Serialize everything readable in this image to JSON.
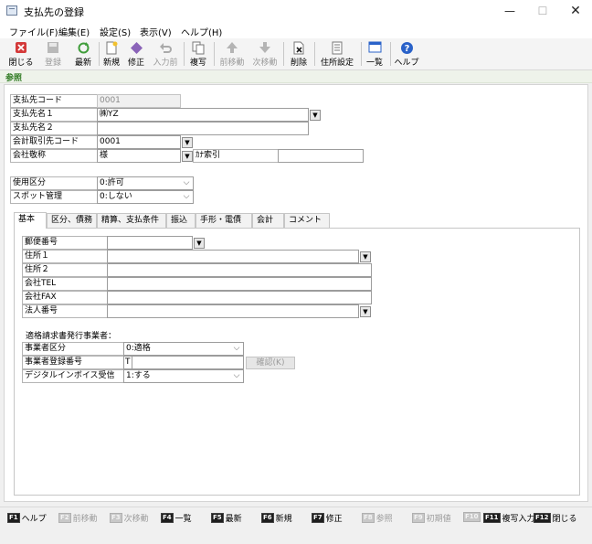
{
  "window": {
    "title": "支払先の登録",
    "minimize": "—",
    "maximize": "☐",
    "close": "✕"
  },
  "menu": [
    "ファイル(F)",
    "編集(E)",
    "設定(S)",
    "表示(V)",
    "ヘルプ(H)"
  ],
  "toolbar": {
    "close": "閉じる",
    "register": "登録",
    "refresh": "最新",
    "new": "新規",
    "edit": "修正",
    "input_before": "入力前",
    "copy": "複写",
    "prev": "前移動",
    "next": "次移動",
    "delete": "削除",
    "address_setting": "住所設定",
    "list": "一覧",
    "help": "ヘルプ"
  },
  "mode": "参照",
  "header_fields": {
    "code_label": "支払先コード",
    "code_value": "0001",
    "name1_label": "支払先名１",
    "name1_value": "㈱YZ",
    "name2_label": "支払先名２",
    "name2_value": "",
    "acct_label": "会計取引先コード",
    "acct_value": "0001",
    "honorific_label": "会社敬称",
    "honorific_value": "様",
    "kana_label": "ｶﾅ索引",
    "kana_value": "",
    "usage_label": "使用区分",
    "usage_value": "0:許可",
    "spot_label": "スポット管理",
    "spot_value": "0:しない"
  },
  "tabs": [
    "基本",
    "区分、債務",
    "精算、支払条件",
    "振込",
    "手形・電債",
    "会計",
    "コメント"
  ],
  "basic": {
    "postal_label": "郵便番号",
    "postal_value": "",
    "addr1_label": "住所１",
    "addr1_value": "",
    "addr2_label": "住所２",
    "addr2_value": "",
    "tel_label": "会社TEL",
    "tel_value": "",
    "fax_label": "会社FAX",
    "fax_value": "",
    "corp_no_label": "法人番号",
    "corp_no_value": "",
    "invoice_heading": "適格請求書発行事業者：",
    "biz_type_label": "事業者区分",
    "biz_type_value": "0:適格",
    "reg_no_label": "事業者登録番号",
    "reg_no_prefix": "T",
    "reg_no_value": "",
    "check_button": "確認(K)",
    "digital_label": "デジタルインボイス受信",
    "digital_value": "1:する"
  },
  "fkeys": [
    {
      "key": "F1",
      "label": "ヘルプ"
    },
    {
      "key": "F2",
      "label": "前移動"
    },
    {
      "key": "F3",
      "label": "次移動"
    },
    {
      "key": "F4",
      "label": "一覧"
    },
    {
      "key": "F5",
      "label": "最新"
    },
    {
      "key": "F6",
      "label": "新規"
    },
    {
      "key": "F7",
      "label": "修正"
    },
    {
      "key": "F8",
      "label": "参照"
    },
    {
      "key": "F9",
      "label": "初期値"
    },
    {
      "key": "F10",
      "label": ""
    },
    {
      "key": "F11",
      "label": "複写入力"
    },
    {
      "key": "F12",
      "label": "閉じる"
    }
  ],
  "colors": {
    "mode_green": "#2f7a22",
    "close_red": "#d43a3a",
    "help_blue": "#2a62c9"
  }
}
